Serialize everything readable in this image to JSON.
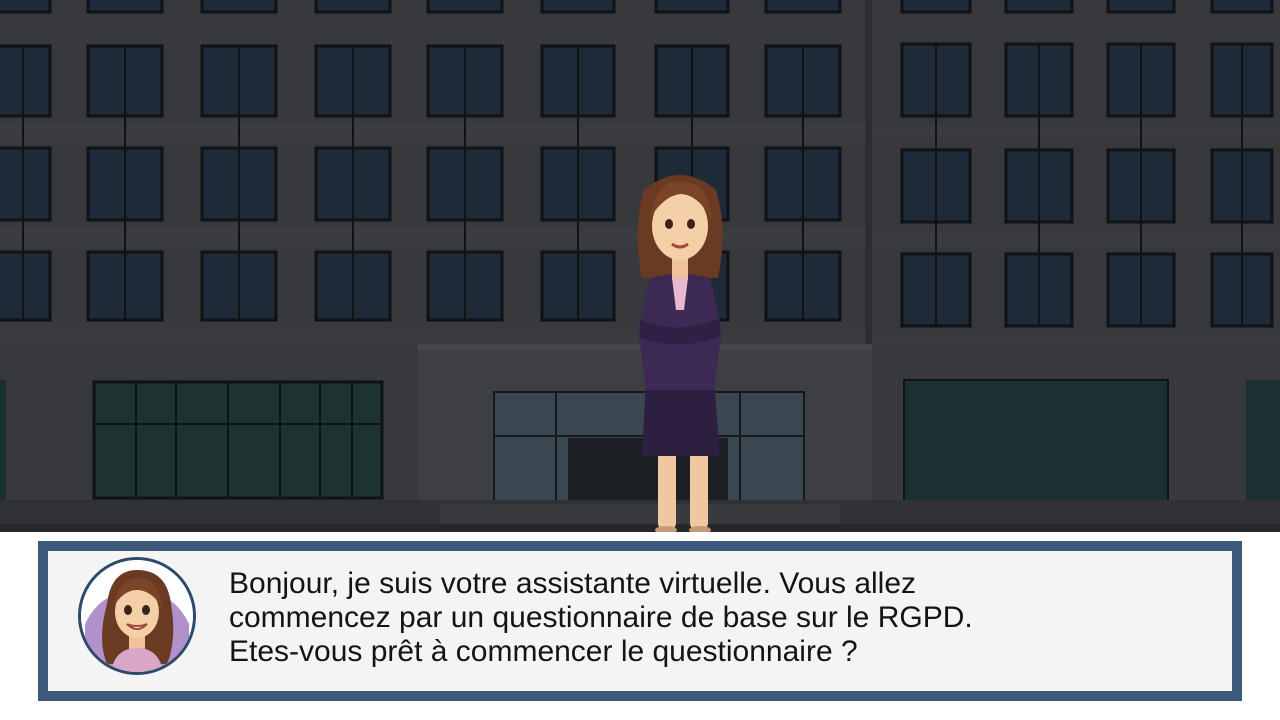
{
  "scene": {
    "background": "office-building-at-night",
    "character": "virtual-assistant-woman-in-suit"
  },
  "dialog": {
    "avatar_icon": "assistant-avatar-icon",
    "message": "Bonjour, je suis votre assistante virtuelle. Vous allez\ncommencez par un questionnaire de base sur le RGPD.\nEtes-vous prêt à commencer le questionnaire ?"
  },
  "colors": {
    "dialog_border": "#3d5a7c",
    "dialog_background": "#f4f4f4",
    "building_wall": "#383a3f",
    "window_glass": "#1f2a39"
  }
}
